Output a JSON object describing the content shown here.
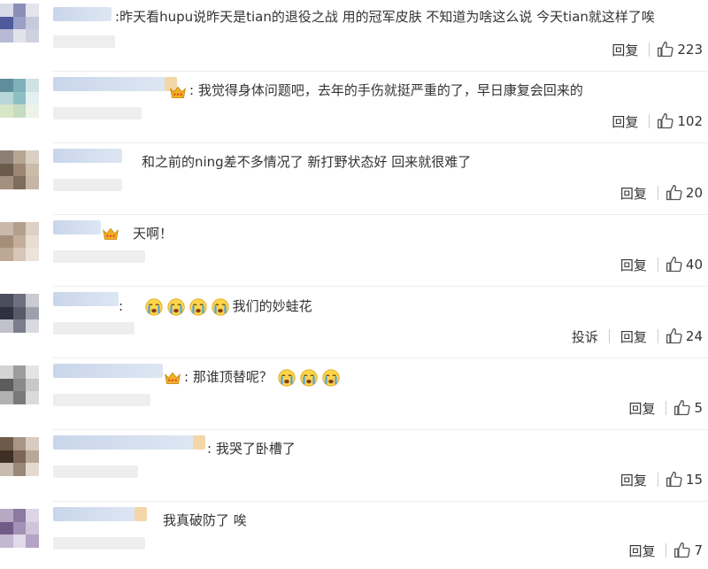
{
  "labels": {
    "reply": "回复",
    "report": "投诉",
    "colon": ":"
  },
  "comments": [
    {
      "text": "昨天看hupu说昨天是tian的退役之战 用的冠军皮肤 不知道为啥这么说 今天tian就这样了唉",
      "likes": "223",
      "has_report": false,
      "crown": false,
      "emoji_count": 0
    },
    {
      "text": "我觉得身体问题吧，去年的手伤就挺严重的了，早日康复会回来的",
      "likes": "102",
      "has_report": false,
      "crown": true,
      "emoji_count": 0
    },
    {
      "text": "和之前的ning差不多情况了 新打野状态好 回来就很难了",
      "likes": "20",
      "has_report": false,
      "crown": false,
      "emoji_count": 0
    },
    {
      "text": "天啊！",
      "likes": "40",
      "has_report": false,
      "crown": true,
      "emoji_count": 0
    },
    {
      "text": "我们的妙蛙花",
      "likes": "24",
      "has_report": true,
      "crown": false,
      "emoji_count": 4
    },
    {
      "text": "那谁顶替呢？",
      "likes": "5",
      "has_report": false,
      "crown": true,
      "emoji_count": 3
    },
    {
      "text": "我哭了卧槽了",
      "likes": "15",
      "has_report": false,
      "crown": false,
      "emoji_count": 0
    },
    {
      "text": "我真破防了 唉",
      "likes": "7",
      "has_report": false,
      "crown": false,
      "emoji_count": 0
    }
  ],
  "colors": {
    "text": "#333333",
    "name_blur": "#c9d6ea",
    "divider": "#ededed",
    "crown": "#f2b01e",
    "emoji_face": "#ffd54a",
    "emoji_tears": "#4aa3e8"
  },
  "icons": {
    "like": "thumbs-up-icon",
    "crown": "crown-icon",
    "emoji": "crying-face-icon"
  }
}
